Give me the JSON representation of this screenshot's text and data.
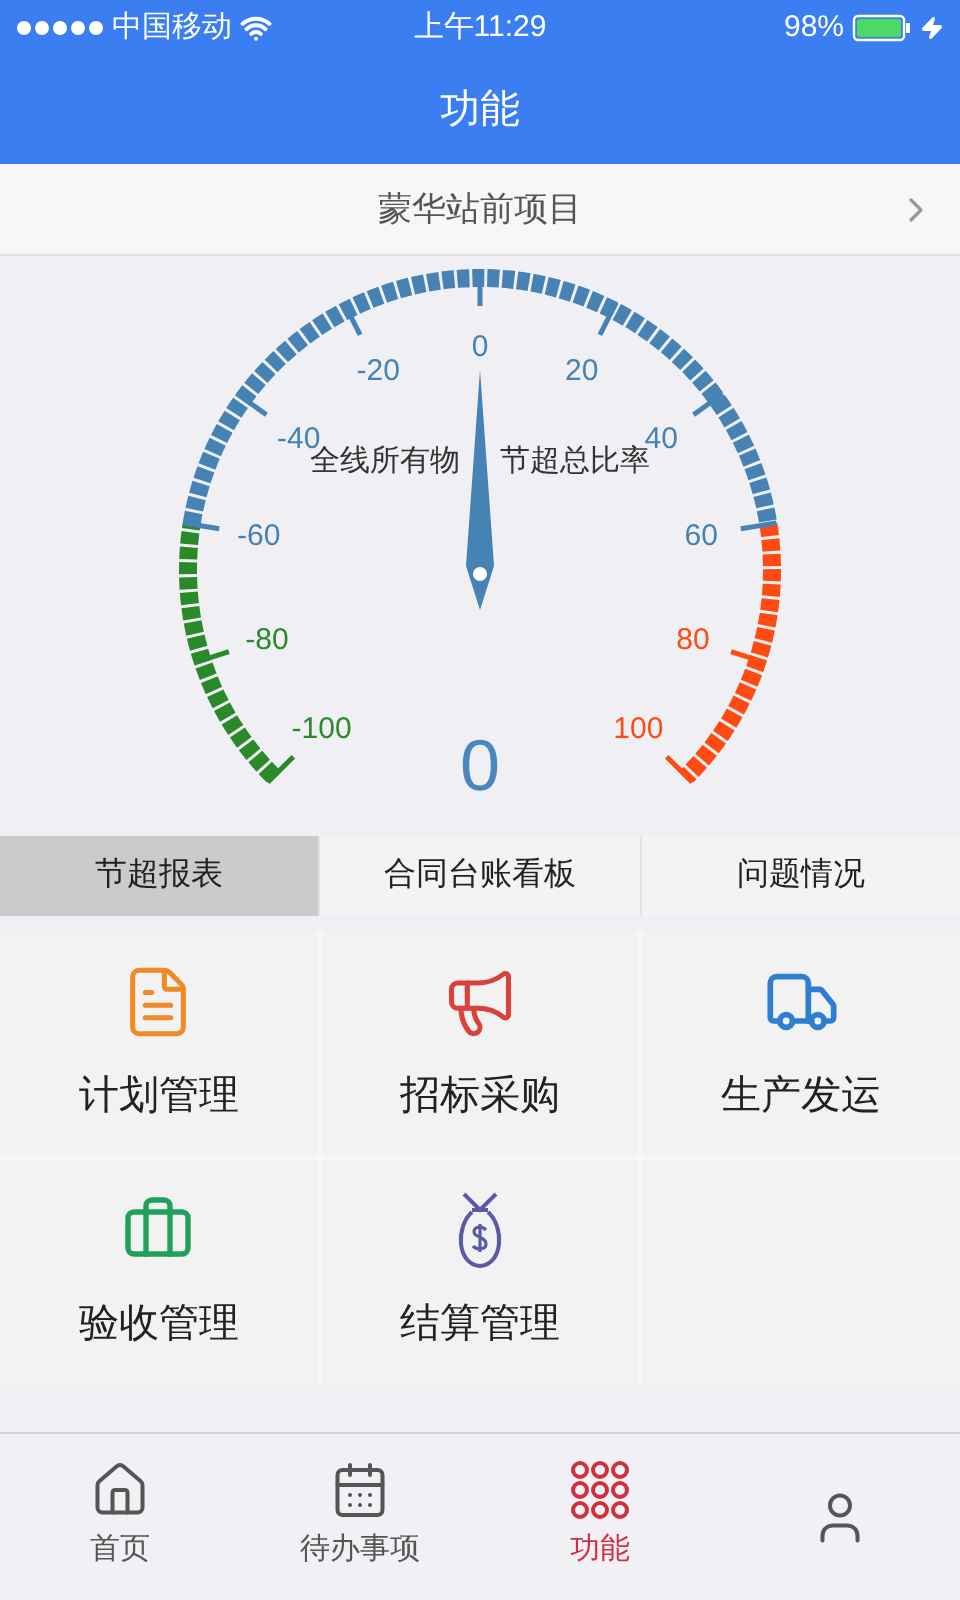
{
  "status_bar": {
    "carrier": "中国移动",
    "time": "上午11:29",
    "battery": "98%"
  },
  "header": {
    "title": "功能"
  },
  "project": {
    "name": "蒙华站前项目"
  },
  "gauge": {
    "title_parts": [
      "全线所有物",
      "节超总比率"
    ],
    "reading": "0",
    "level": 0.5,
    "ticks": [
      "-100",
      "-80",
      "-60",
      "-40",
      "-20",
      "0",
      "20",
      "40",
      "60",
      "80",
      "100"
    ]
  },
  "tabs": [
    {
      "label": "节超报表",
      "selected": true
    },
    {
      "label": "合同台账看板",
      "selected": false
    },
    {
      "label": "问题情况",
      "selected": false
    }
  ],
  "modules": [
    {
      "label": "计划管理"
    },
    {
      "label": "招标采购"
    },
    {
      "label": "生产发运"
    },
    {
      "label": "验收管理"
    },
    {
      "label": "结算管理"
    }
  ],
  "bottom_nav": [
    {
      "label": "首页",
      "selected": false
    },
    {
      "label": "待办事项",
      "selected": false
    },
    {
      "label": "功能",
      "selected": true
    },
    {
      "selected": false
    }
  ]
}
